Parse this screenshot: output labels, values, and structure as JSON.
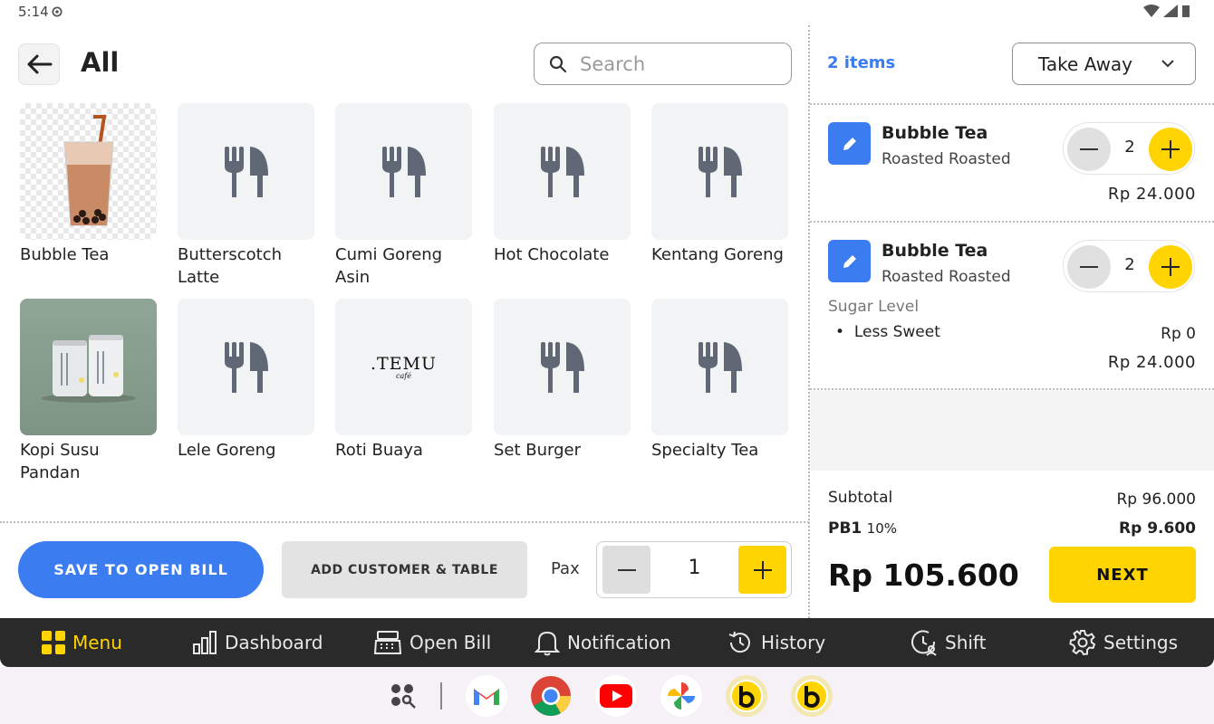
{
  "status": {
    "time": "5:14"
  },
  "header": {
    "title": "All",
    "search_placeholder": "Search"
  },
  "products": [
    {
      "name": "Bubble Tea",
      "image": "bubble-tea-photo"
    },
    {
      "name": "Butterscotch Latte",
      "image": "utensils-icon"
    },
    {
      "name": "Cumi Goreng Asin",
      "image": "utensils-icon"
    },
    {
      "name": "Hot Chocolate",
      "image": "utensils-icon"
    },
    {
      "name": "Kentang Goreng",
      "image": "utensils-icon"
    },
    {
      "name": "Kopi Susu Pandan",
      "image": "cans-photo"
    },
    {
      "name": "Lele Goreng",
      "image": "utensils-icon"
    },
    {
      "name": "Roti Buaya",
      "image": "temu-cafe-logo",
      "logo_text": ".TEMU",
      "logo_sub": "café"
    },
    {
      "name": "Set Burger",
      "image": "utensils-icon"
    },
    {
      "name": "Specialty Tea",
      "image": "utensils-icon"
    }
  ],
  "actions": {
    "save_label": "SAVE TO OPEN BILL",
    "customer_label": "ADD CUSTOMER & TABLE",
    "pax_label": "Pax",
    "pax_value": "1"
  },
  "cart": {
    "count_label": "2 items",
    "order_type": "Take Away",
    "items": [
      {
        "name": "Bubble Tea",
        "variant": "Roasted Roasted",
        "qty": "2",
        "price": "Rp 24.000"
      },
      {
        "name": "Bubble Tea",
        "variant": "Roasted Roasted",
        "qty": "2",
        "price": "Rp 24.000",
        "modifier_group": "Sugar Level",
        "modifier": "Less Sweet",
        "modifier_price": "Rp 0"
      }
    ],
    "subtotal_label": "Subtotal",
    "subtotal": "Rp 96.000",
    "tax_label": "PB1",
    "tax_rate": "10%",
    "tax": "Rp 9.600",
    "total": "Rp 105.600",
    "next_label": "NEXT"
  },
  "nav": [
    {
      "label": "Menu",
      "icon": "grid-icon",
      "active": true
    },
    {
      "label": "Dashboard",
      "icon": "bar-chart-icon"
    },
    {
      "label": "Open Bill",
      "icon": "cash-register-icon"
    },
    {
      "label": "Notification",
      "icon": "bell-icon"
    },
    {
      "label": "History",
      "icon": "history-icon"
    },
    {
      "label": "Shift",
      "icon": "shift-icon"
    },
    {
      "label": "Settings",
      "icon": "gear-icon"
    }
  ],
  "taskbar_apps": [
    "app-drawer-icon",
    "gmail-icon",
    "chrome-icon",
    "youtube-icon",
    "photos-icon",
    "bold-app-icon",
    "bold-app-icon"
  ],
  "colors": {
    "accent_blue": "#3b7cf0",
    "accent_yellow": "#ffd400",
    "nav_bg": "#2a2a2a"
  }
}
